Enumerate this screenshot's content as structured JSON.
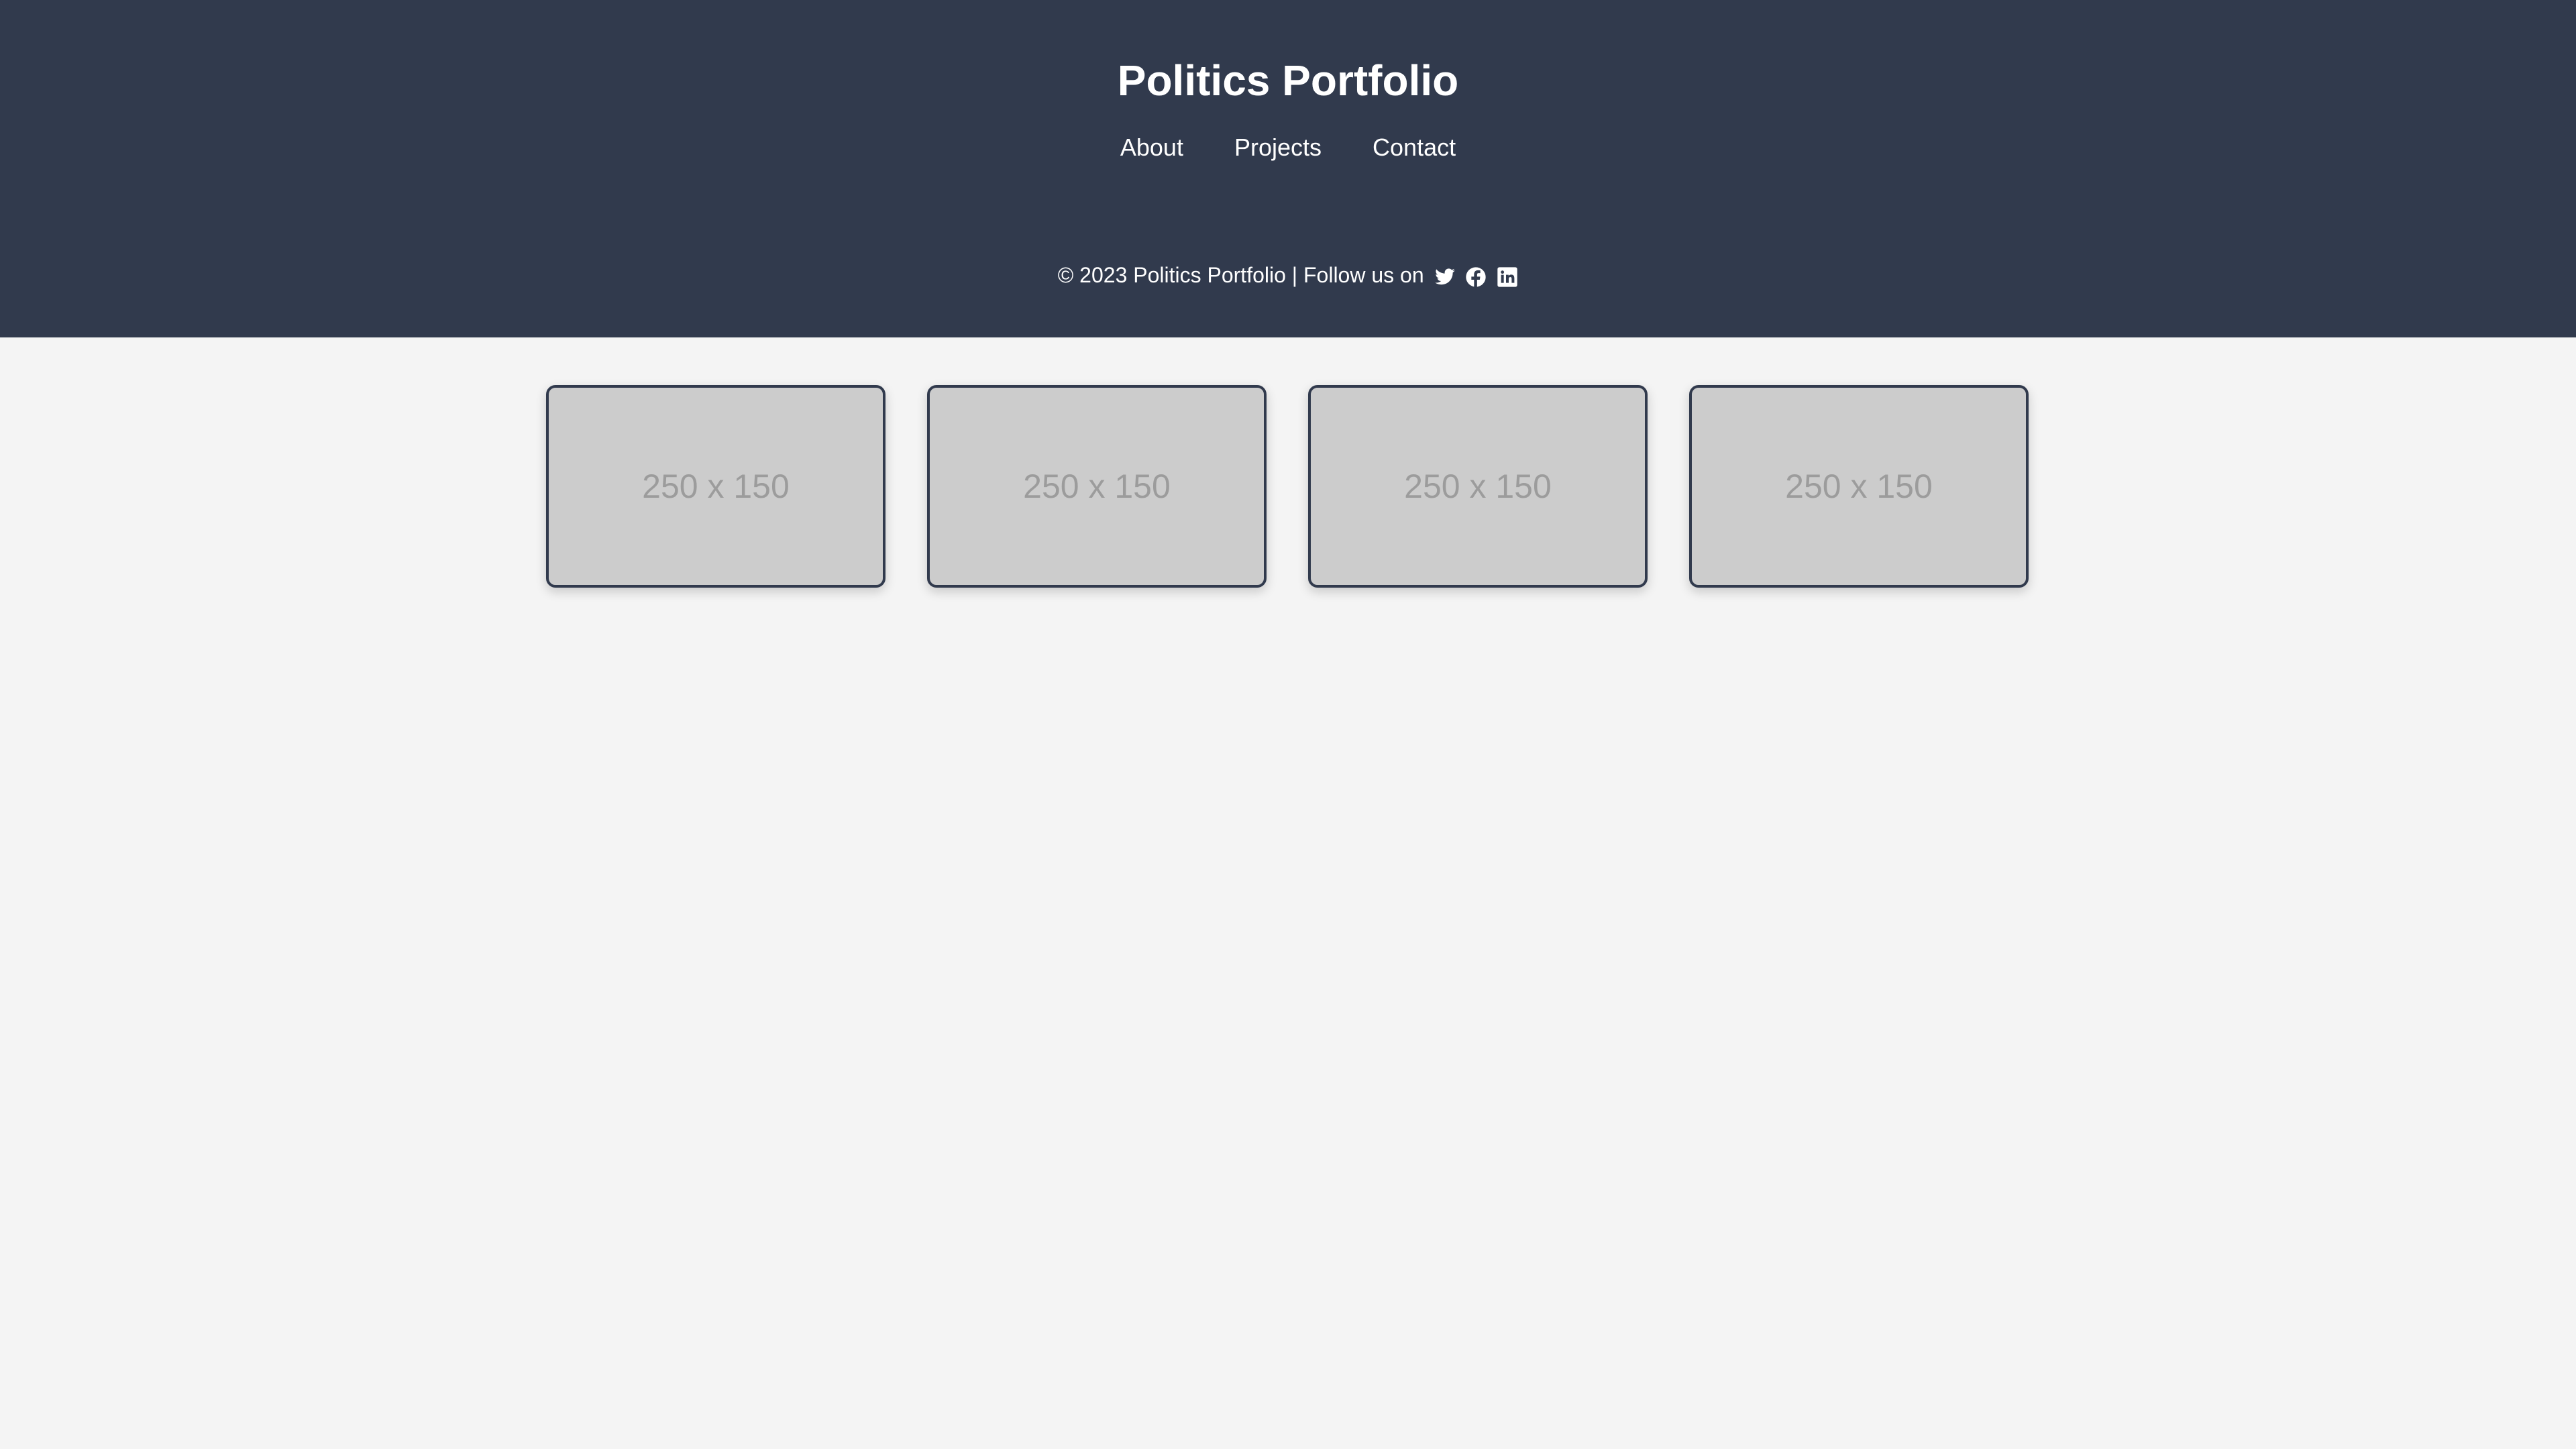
{
  "header": {
    "title": "Politics Portfolio",
    "nav": [
      {
        "label": "About"
      },
      {
        "label": "Projects"
      },
      {
        "label": "Contact"
      }
    ],
    "footer_text": "© 2023 Politics Portfolio | Follow us on",
    "social_icons": [
      "twitter-icon",
      "facebook-icon",
      "linkedin-icon"
    ]
  },
  "gallery": {
    "images": [
      {
        "placeholder": "250 x 150"
      },
      {
        "placeholder": "250 x 150"
      },
      {
        "placeholder": "250 x 150"
      },
      {
        "placeholder": "250 x 150"
      }
    ]
  },
  "colors": {
    "header_bg": "#313a4d",
    "page_bg": "#f4f4f4",
    "card_bg": "#cccccc",
    "card_border": "#313a4d",
    "placeholder_text": "#9c9c9c",
    "header_text": "#ffffff"
  }
}
